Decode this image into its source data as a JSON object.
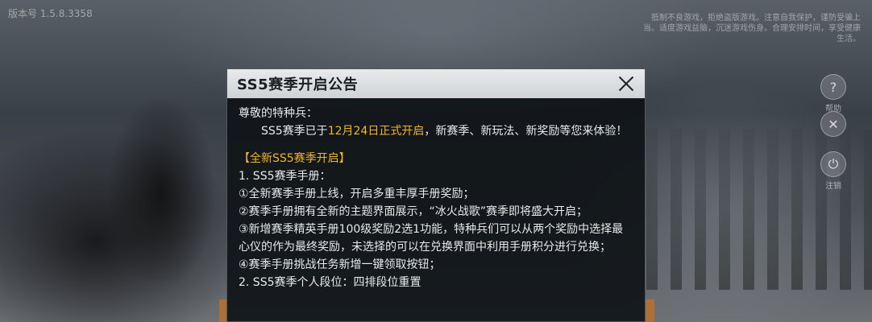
{
  "version": "版本号 1.5.8.3358",
  "top_notice": "抵制不良游戏，拒绝盗版游戏。注意自我保护，谨防受骗上当。适度游戏益脑，沉迷游戏伤身。合理安排时间，享受健康生活。",
  "side_buttons": [
    {
      "label": "帮助",
      "icon": "help-icon"
    },
    {
      "label": "",
      "icon": "tools-icon"
    },
    {
      "label": "注销",
      "icon": "power-icon"
    }
  ],
  "dialog": {
    "title": "SS5赛季开启公告",
    "greeting": "尊敬的特种兵：",
    "intro_pre": "SS5赛季已于",
    "intro_highlight": "12月24日正式开启",
    "intro_post": "，新赛季、新玩法、新奖励等您来体验！",
    "section_heading": "【全新SS5赛季开启】",
    "lines": [
      "1. SS5赛季手册：",
      "①全新赛季手册上线，开启多重丰厚手册奖励；",
      "②赛季手册拥有全新的主题界面展示，“冰火战歌”赛季即将盛大开启；",
      "③新增赛季精英手册100级奖励2选1功能，特种兵们可以从两个奖励中选择最心仪的作为最终奖励，未选择的可以在兑换界面中利用手册积分进行兑换；",
      "④赛季手册挑战任务新增一键领取按钮；",
      "2. SS5赛季个人段位：四排段位重置"
    ]
  },
  "colors": {
    "highlight": "#f0b531",
    "text": "#e7e9ea",
    "header_bg": "#dcdfe1"
  }
}
